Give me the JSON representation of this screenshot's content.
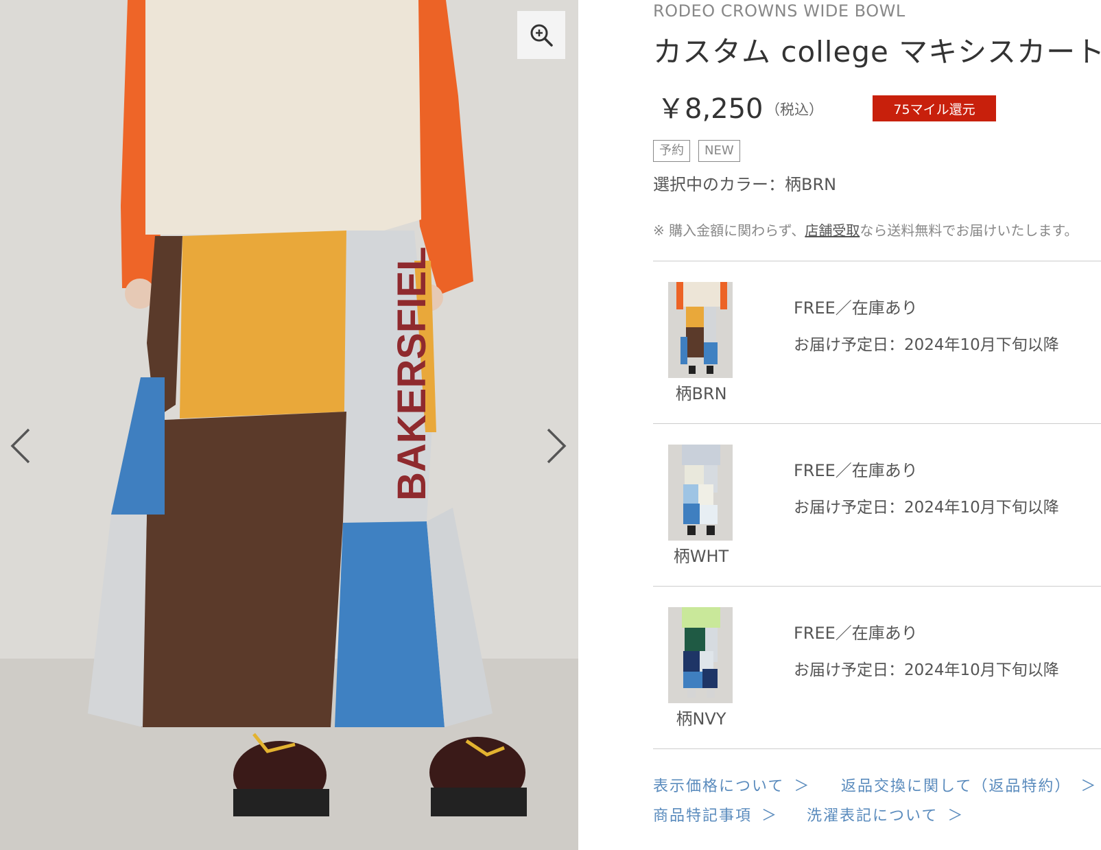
{
  "gallery": {
    "zoom_icon": "zoom-in-icon",
    "prev_icon": "chevron-left-icon",
    "next_icon": "chevron-right-icon",
    "photo_print_text": "BAKERSFIEL"
  },
  "product": {
    "brand": "RODEO CROWNS WIDE BOWL",
    "title": "カスタム college マキシスカート",
    "price": "￥8,250",
    "tax_note": "（税込）",
    "miles_badge": "75マイル還元",
    "tags": [
      "予約",
      "NEW"
    ],
    "selected_color": "選択中のカラー：柄BRN",
    "notice_prefix": "※ 購入金額に関わらず、",
    "notice_link": "店舗受取",
    "notice_suffix": "なら送料無料でお届けいたします。"
  },
  "variants": [
    {
      "label": "柄BRN",
      "stock": "FREE／在庫あり",
      "delivery": "お届け予定日：2024年10月下旬以降"
    },
    {
      "label": "柄WHT",
      "stock": "FREE／在庫あり",
      "delivery": "お届け予定日：2024年10月下旬以降"
    },
    {
      "label": "柄NVY",
      "stock": "FREE／在庫あり",
      "delivery": "お届け予定日：2024年10月下旬以降"
    }
  ],
  "links": {
    "price_info": "表示価格について",
    "returns": "返品交換に関して（返品特約）",
    "product_notes": "商品特記事項",
    "care_label": "洗濯表記について",
    "chevron": "＞",
    "chevron_icon": "chevron-right-icon"
  },
  "colors": {
    "accent_red": "#c8200c",
    "link_blue": "#5a8bbd"
  }
}
